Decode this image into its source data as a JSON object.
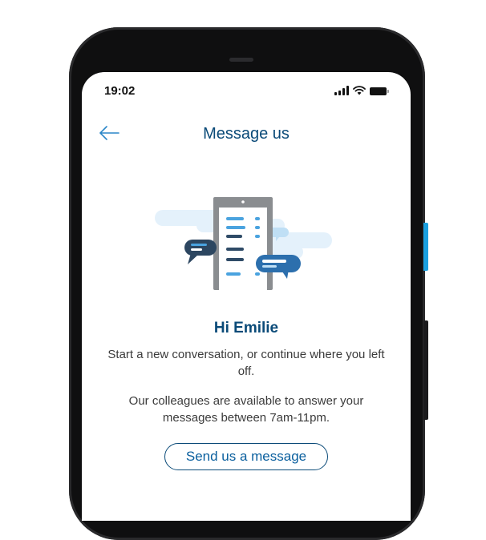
{
  "status_bar": {
    "time": "19:02",
    "icons": [
      "signal-icon",
      "wifi-icon",
      "battery-icon"
    ]
  },
  "header": {
    "back_icon": "arrow-left-icon",
    "title": "Message us"
  },
  "illustration": {
    "icon": "phone-chat-illustration"
  },
  "content": {
    "greeting": "Hi Emilie",
    "intro": "Start a new conversation, or continue where you left off.",
    "availability": "Our colleagues are available to answer your messages between 7am-11pm."
  },
  "actions": {
    "send_label": "Send us a message"
  },
  "colors": {
    "brand": "#0a4a78",
    "accent": "#4aa3df",
    "text": "#3b3b3b",
    "side_button": "#1aa0e0"
  }
}
